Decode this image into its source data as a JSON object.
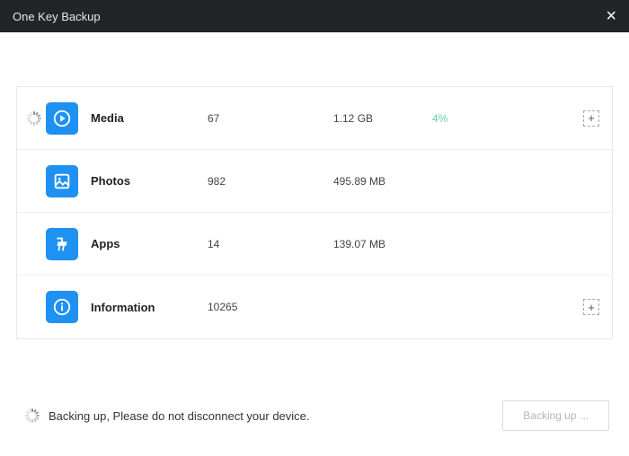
{
  "header": {
    "title": "One Key Backup"
  },
  "rows": [
    {
      "label": "Media",
      "count": "67",
      "size": "1.12 GB",
      "percent": "4%",
      "has_spinner": true,
      "has_add": true
    },
    {
      "label": "Photos",
      "count": "982",
      "size": "495.89 MB",
      "percent": "",
      "has_spinner": false,
      "has_add": false
    },
    {
      "label": "Apps",
      "count": "14",
      "size": "139.07 MB",
      "percent": "",
      "has_spinner": false,
      "has_add": false
    },
    {
      "label": "Information",
      "count": "10265",
      "size": "",
      "percent": "",
      "has_spinner": false,
      "has_add": true
    }
  ],
  "footer": {
    "message": "Backing up, Please do not disconnect your device.",
    "button": "Backing up ..."
  }
}
